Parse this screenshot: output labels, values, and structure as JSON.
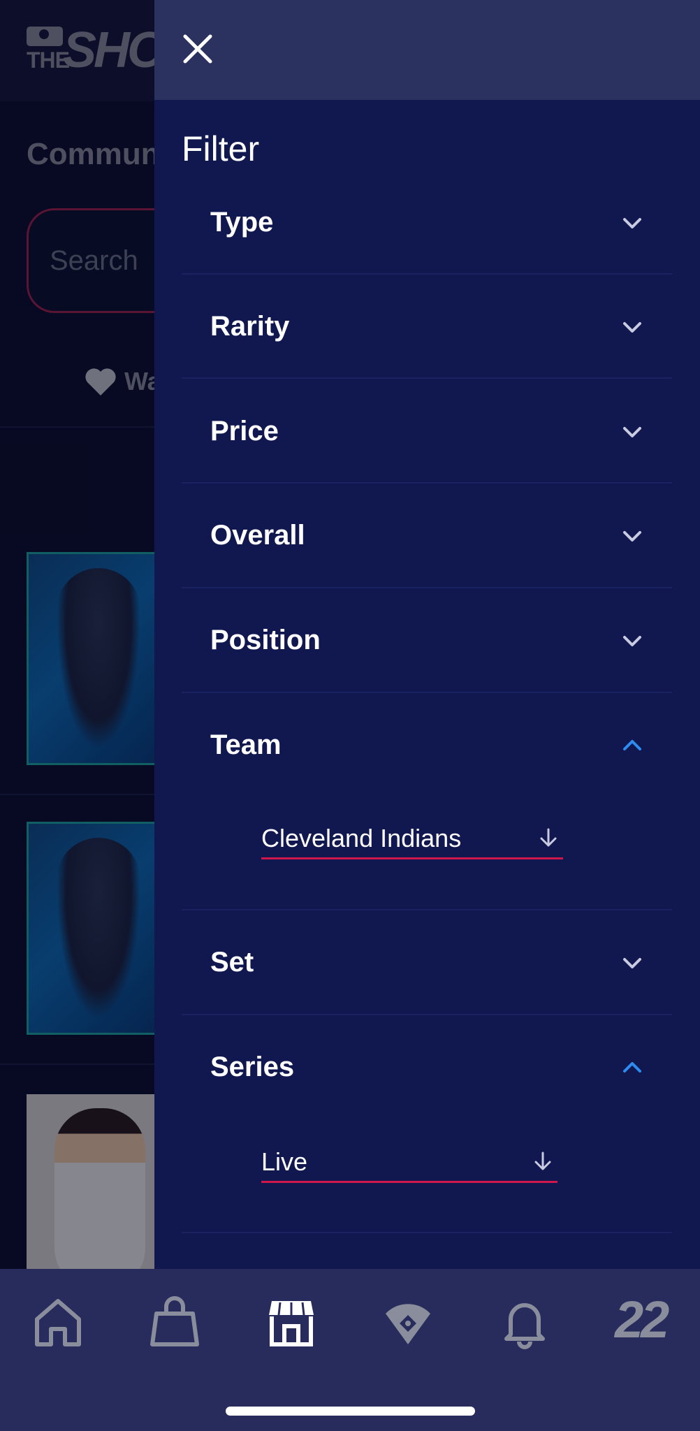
{
  "background": {
    "logo_text_top": "THE",
    "logo_text_main": "SHOW",
    "page_title": "Community Market",
    "search_placeholder": "Search",
    "watchlist_label": "Watchlist"
  },
  "drawer": {
    "title": "Filter",
    "sections": [
      {
        "label": "Type",
        "expanded": false
      },
      {
        "label": "Rarity",
        "expanded": false
      },
      {
        "label": "Price",
        "expanded": false
      },
      {
        "label": "Overall",
        "expanded": false
      },
      {
        "label": "Position",
        "expanded": false
      },
      {
        "label": "Team",
        "expanded": true,
        "selected": "Cleveland Indians"
      },
      {
        "label": "Set",
        "expanded": false
      },
      {
        "label": "Series",
        "expanded": true,
        "selected": "Live"
      }
    ]
  },
  "bottom_nav": {
    "items": [
      "home-icon",
      "shop-bag-icon",
      "marketplace-icon",
      "diamond-field-icon",
      "bell-icon"
    ],
    "active": "marketplace-icon",
    "year_label": "22"
  },
  "colors": {
    "drawer_bg": "#11174f",
    "drawer_header": "#2b3260",
    "accent_blue": "#2e8cf0",
    "underline_red": "#d0174c",
    "nav_bg": "#272c5c",
    "nav_inactive": "#8a8d9c"
  }
}
